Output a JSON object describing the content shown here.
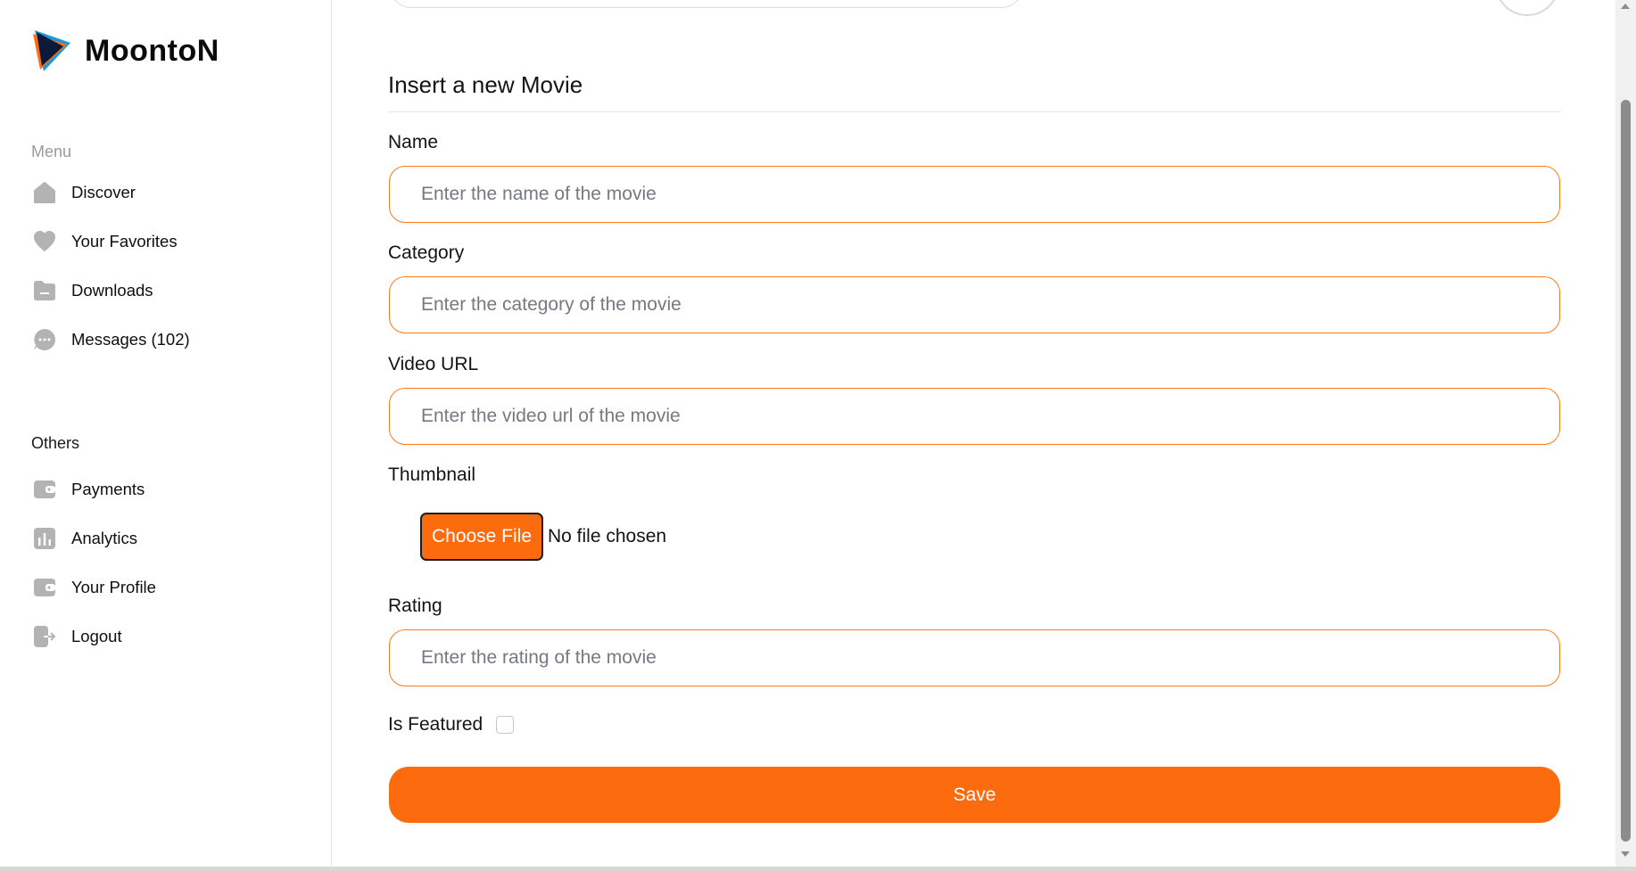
{
  "app": {
    "name": "MoontoN",
    "accent_color": "#fd6b0f"
  },
  "sidebar": {
    "menu_title": "Menu",
    "menu_items": [
      {
        "label": "Discover",
        "icon": "home-icon"
      },
      {
        "label": "Your Favorites",
        "icon": "heart-icon"
      },
      {
        "label": "Downloads",
        "icon": "folder-icon"
      },
      {
        "label": "Messages (102)",
        "icon": "chat-icon"
      }
    ],
    "others_title": "Others",
    "other_items": [
      {
        "label": "Payments",
        "icon": "wallet-icon"
      },
      {
        "label": "Analytics",
        "icon": "chart-icon"
      },
      {
        "label": "Your Profile",
        "icon": "wallet-icon"
      },
      {
        "label": "Logout",
        "icon": "logout-icon"
      }
    ]
  },
  "form": {
    "title": "Insert a new Movie",
    "name_label": "Name",
    "name_placeholder": "Enter the name of the movie",
    "category_label": "Category",
    "category_placeholder": "Enter the category of the movie",
    "video_url_label": "Video URL",
    "video_url_placeholder": "Enter the video url of the movie",
    "thumbnail_label": "Thumbnail",
    "file_button": "Choose File",
    "file_status": "No file chosen",
    "rating_label": "Rating",
    "rating_placeholder": "Enter the rating of the movie",
    "featured_label": "Is Featured",
    "featured_checked": false,
    "save_label": "Save"
  }
}
